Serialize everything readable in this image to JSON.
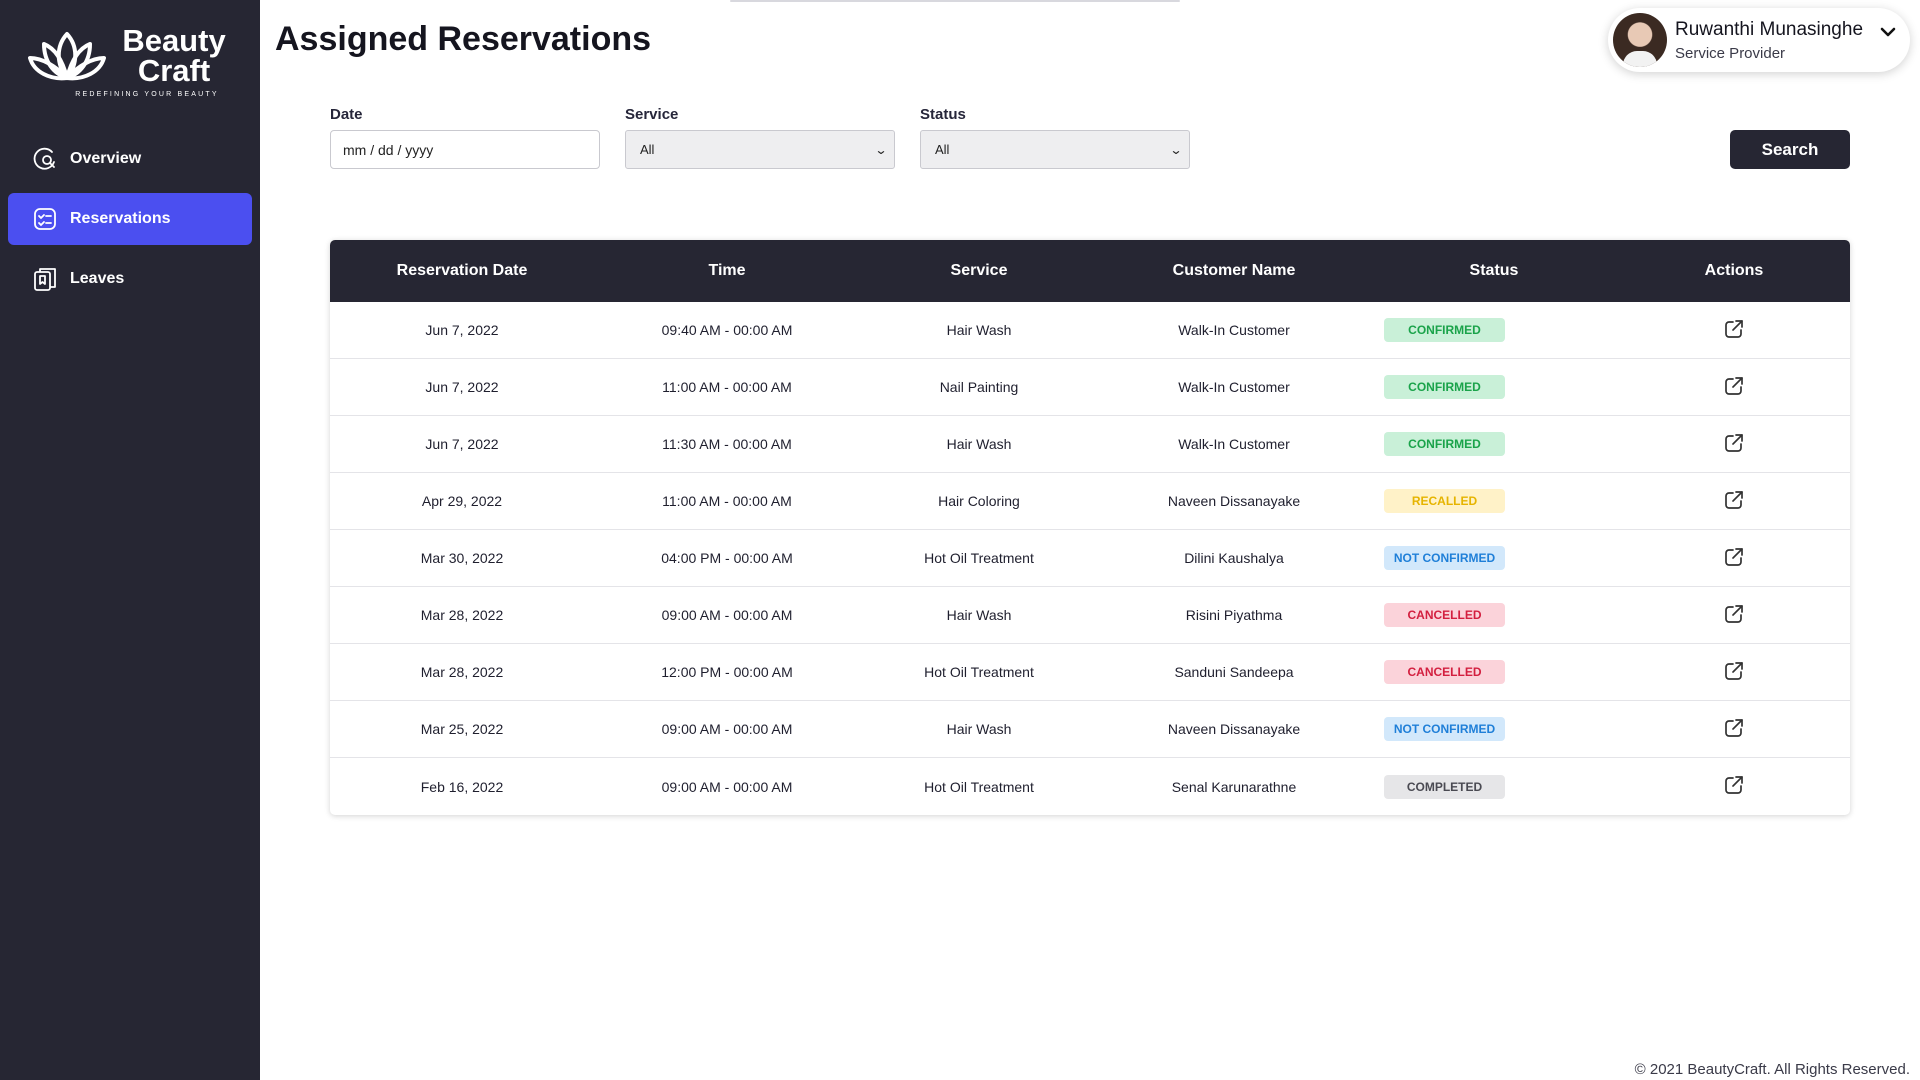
{
  "brand": {
    "name": "Beauty Craft",
    "tagline": "REDEFINING YOUR BEAUTY"
  },
  "sidebar": {
    "items": [
      {
        "label": "Overview",
        "icon": "overview-icon",
        "active": false
      },
      {
        "label": "Reservations",
        "icon": "reservations-icon",
        "active": true
      },
      {
        "label": "Leaves",
        "icon": "leaves-icon",
        "active": false
      }
    ]
  },
  "header": {
    "title": "Assigned Reservations"
  },
  "profile": {
    "name": "Ruwanthi Munasinghe",
    "role": "Service Provider"
  },
  "filters": {
    "date": {
      "label": "Date",
      "placeholder": "mm / dd / yyyy"
    },
    "service": {
      "label": "Service",
      "value": "All"
    },
    "status": {
      "label": "Status",
      "value": "All"
    },
    "search_label": "Search"
  },
  "table": {
    "columns": [
      "Reservation Date",
      "Time",
      "Service",
      "Customer Name",
      "Status",
      "Actions"
    ],
    "rows": [
      {
        "date": "Jun 7, 2022",
        "time": "09:40 AM - 00:00 AM",
        "service": "Hair Wash",
        "customer": "Walk-In Customer",
        "status": "CONFIRMED"
      },
      {
        "date": "Jun 7, 2022",
        "time": "11:00 AM - 00:00 AM",
        "service": "Nail Painting",
        "customer": "Walk-In Customer",
        "status": "CONFIRMED"
      },
      {
        "date": "Jun 7, 2022",
        "time": "11:30 AM - 00:00 AM",
        "service": "Hair Wash",
        "customer": "Walk-In Customer",
        "status": "CONFIRMED"
      },
      {
        "date": "Apr 29, 2022",
        "time": "11:00 AM - 00:00 AM",
        "service": "Hair Coloring",
        "customer": "Naveen Dissanayake",
        "status": "RECALLED"
      },
      {
        "date": "Mar 30, 2022",
        "time": "04:00 PM - 00:00 AM",
        "service": "Hot Oil Treatment",
        "customer": "Dilini Kaushalya",
        "status": "NOT CONFIRMED"
      },
      {
        "date": "Mar 28, 2022",
        "time": "09:00 AM - 00:00 AM",
        "service": "Hair Wash",
        "customer": "Risini Piyathma",
        "status": "CANCELLED"
      },
      {
        "date": "Mar 28, 2022",
        "time": "12:00 PM - 00:00 AM",
        "service": "Hot Oil Treatment",
        "customer": "Sanduni Sandeepa",
        "status": "CANCELLED"
      },
      {
        "date": "Mar 25, 2022",
        "time": "09:00 AM - 00:00 AM",
        "service": "Hair Wash",
        "customer": "Naveen Dissanayake",
        "status": "NOT CONFIRMED"
      },
      {
        "date": "Feb 16, 2022",
        "time": "09:00 AM - 00:00 AM",
        "service": "Hot Oil Treatment",
        "customer": "Senal Karunarathne",
        "status": "COMPLETED"
      }
    ],
    "action_icon": "external-link-icon"
  },
  "footer": {
    "copyright": "© 2021 BeautyCraft. All Rights Reserved."
  },
  "colors": {
    "sidebar_bg": "#262633",
    "accent": "#4b4ff0",
    "confirmed": "#1aa34a",
    "recalled": "#e6b400",
    "not_confirmed": "#1f7fd8",
    "cancelled": "#d31f3f",
    "completed": "#4a4a52"
  }
}
